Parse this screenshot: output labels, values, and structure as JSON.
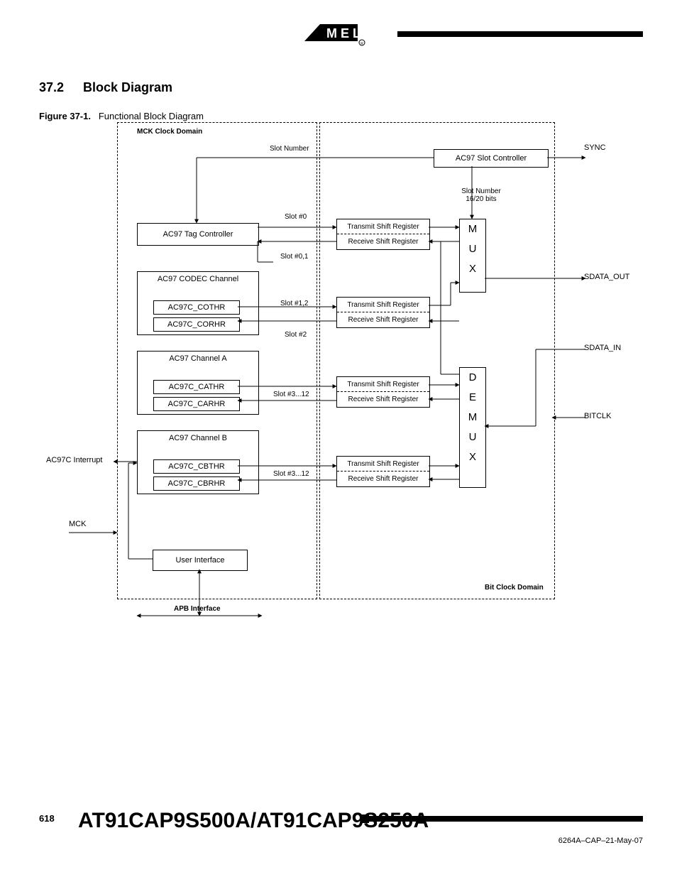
{
  "section_num": "37.2",
  "section_title": "Block Diagram",
  "figure_prefix": "Figure 37-1.",
  "figure_caption": "Functional Block Diagram",
  "page_number": "618",
  "chip_name": "AT91CAP9S500A/AT91CAP9S250A",
  "doc_code": "6264A–CAP–21-May-07",
  "domains": {
    "mck": "MCK Clock Domain",
    "bit": "Bit Clock Domain"
  },
  "blocks": {
    "tag": "AC97 Tag Controller",
    "codec": "AC97 CODEC Channel",
    "cothr": "AC97C_COTHR",
    "corhr": "AC97C_CORHR",
    "cha": "AC97 Channel A",
    "cathr": "AC97C_CATHR",
    "carhr": "AC97C_CARHR",
    "chb": "AC97 Channel B",
    "cbthr": "AC97C_CBTHR",
    "cbrhr": "AC97C_CBRHR",
    "ui": "User Interface",
    "slotctrl": "AC97 Slot Controller"
  },
  "slots": {
    "s0": "Slot #0",
    "s01": "Slot #0,1",
    "s12": "Slot #1,2",
    "s2": "Slot #2",
    "s312a": "Slot #3...12",
    "s312b": "Slot #3...12",
    "num": "Slot Number",
    "num16": "Slot Number\n16/20 bits"
  },
  "shifts": {
    "tx": "Transmit Shift Register",
    "rx": "Receive Shift Register"
  },
  "mux": {
    "m": "M",
    "u": "U",
    "x": "X",
    "d": "D",
    "e": "E"
  },
  "signals": {
    "sync": "SYNC",
    "sdout": "SDATA_OUT",
    "sdin": "SDATA_IN",
    "bitclk": "BITCLK",
    "mck": "MCK",
    "int": "AC97C Interrupt",
    "apb": "APB Interface"
  }
}
